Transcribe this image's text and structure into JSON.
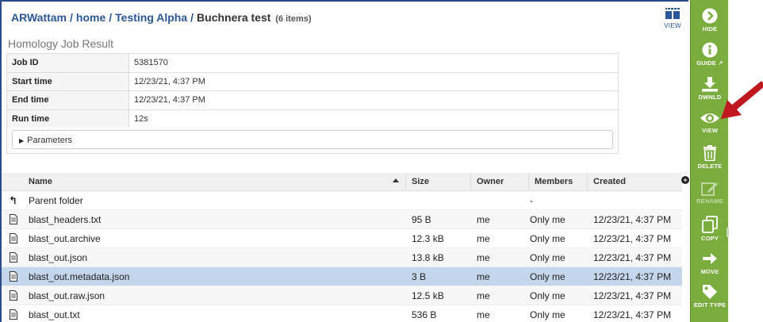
{
  "breadcrumb": {
    "items": [
      "ARWattam",
      "home",
      "Testing Alpha"
    ],
    "separator": "/",
    "current": "Buchnera test",
    "count": "(6 items)"
  },
  "view_toggle": {
    "label": "VIEW",
    "icon": "grid-list-icon"
  },
  "job_result": {
    "title": "Homology Job Result",
    "rows": [
      {
        "key": "Job ID",
        "value": "5381570"
      },
      {
        "key": "Start time",
        "value": "12/23/21, 4:37 PM"
      },
      {
        "key": "End time",
        "value": "12/23/21, 4:37 PM"
      },
      {
        "key": "Run time",
        "value": "12s"
      }
    ],
    "parameters_label": "Parameters"
  },
  "grid": {
    "columns": [
      "Name",
      "Size",
      "Owner",
      "Members",
      "Created"
    ],
    "sort_column": "Name",
    "parent_row": {
      "name": "Parent folder",
      "members": "-"
    },
    "rows": [
      {
        "name": "blast_headers.txt",
        "size": "95 B",
        "owner": "me",
        "members": "Only me",
        "created": "12/23/21, 4:37 PM",
        "selected": false
      },
      {
        "name": "blast_out.archive",
        "size": "12.3 kB",
        "owner": "me",
        "members": "Only me",
        "created": "12/23/21, 4:37 PM",
        "selected": false
      },
      {
        "name": "blast_out.json",
        "size": "13.8 kB",
        "owner": "me",
        "members": "Only me",
        "created": "12/23/21, 4:37 PM",
        "selected": false
      },
      {
        "name": "blast_out.metadata.json",
        "size": "3 B",
        "owner": "me",
        "members": "Only me",
        "created": "12/23/21, 4:37 PM",
        "selected": true
      },
      {
        "name": "blast_out.raw.json",
        "size": "12.5 kB",
        "owner": "me",
        "members": "Only me",
        "created": "12/23/21, 4:37 PM",
        "selected": false
      },
      {
        "name": "blast_out.txt",
        "size": "536 B",
        "owner": "me",
        "members": "Only me",
        "created": "12/23/21, 4:37 PM",
        "selected": false
      }
    ]
  },
  "sidebar": {
    "items": [
      {
        "label": "HIDE",
        "icon": "chevron-right-circle-icon",
        "enabled": true
      },
      {
        "label": "GUIDE",
        "icon": "info-circle-icon",
        "enabled": true
      },
      {
        "label": "DWNLD",
        "icon": "download-icon",
        "enabled": true
      },
      {
        "label": "VIEW",
        "icon": "eye-icon",
        "enabled": true
      },
      {
        "label": "DELETE",
        "icon": "trash-icon",
        "enabled": true
      },
      {
        "label": "RENAME",
        "icon": "pencil-icon",
        "enabled": false
      },
      {
        "label": "COPY",
        "icon": "copy-icon",
        "enabled": true
      },
      {
        "label": "MOVE",
        "icon": "arrow-right-icon",
        "enabled": true
      },
      {
        "label": "EDIT TYPE",
        "icon": "tag-icon",
        "enabled": true
      }
    ]
  },
  "colors": {
    "sidebar_bg": "#7bac3e",
    "breadcrumb_link": "#2b5797",
    "selected_row": "#c4d6ec",
    "annotation_arrow": "#c0181f"
  }
}
